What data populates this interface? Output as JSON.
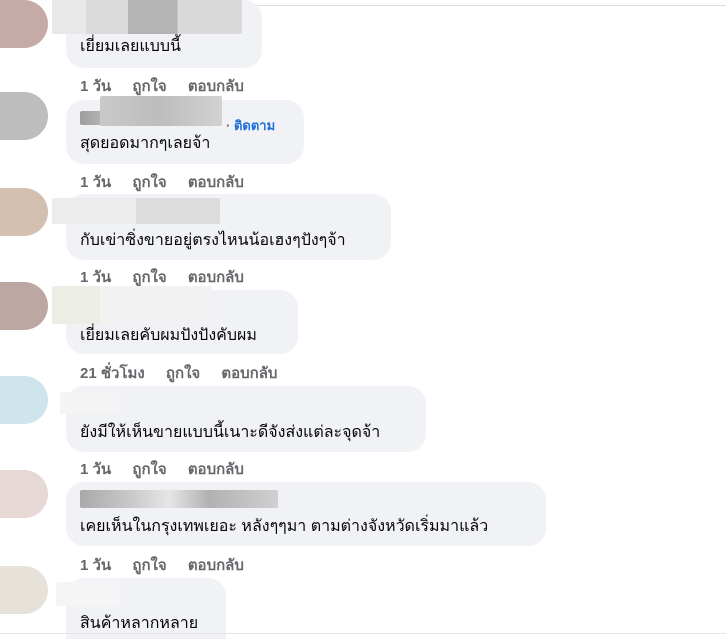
{
  "comments": [
    {
      "text": "เยี่ยมเลยแบบนี้",
      "time": "1 วัน",
      "like": "ถูกใจ",
      "reply": "ตอบกลับ",
      "avatar_color": "#c6aaa8"
    },
    {
      "text": "สุดยอดมากๆเลยจ้า",
      "time": "1 วัน",
      "like": "ถูกใจ",
      "reply": "ตอบกลับ",
      "follow_sep": "·",
      "follow": "ติดตาม",
      "avatar_color": "#bdbdbd"
    },
    {
      "text": "กับเข่าซิ่งขายอยู่ตรงไหนน้อเฮงๆปังๆจ้า",
      "time": "1 วัน",
      "like": "ถูกใจ",
      "reply": "ตอบกลับ",
      "avatar_color": "#d4c0b0"
    },
    {
      "text": "เยี่ยมเลยคับผมปังปังคับผม",
      "time": "21 ชั่วโมง",
      "like": "ถูกใจ",
      "reply": "ตอบกลับ",
      "avatar_color": "#bca7a3"
    },
    {
      "text": "ยังมีให้เห็นขายแบบนี้เนาะดีจังส่งแต่ละจุดจ้า",
      "time": "1 วัน",
      "like": "ถูกใจ",
      "reply": "ตอบกลับ",
      "avatar_color": "#cfe5ee"
    },
    {
      "text": "เคยเห็นในกรุงเทพเยอะ หลังๆๆมา ตามต่างจังหวัดเริ่มมาแล้ว",
      "time": "1 วัน",
      "like": "ถูกใจ",
      "reply": "ตอบกลับ",
      "avatar_color": "#e6d8d4"
    },
    {
      "text": "สินค้าหลากหลาย",
      "avatar_color": "#e6e2da"
    }
  ]
}
